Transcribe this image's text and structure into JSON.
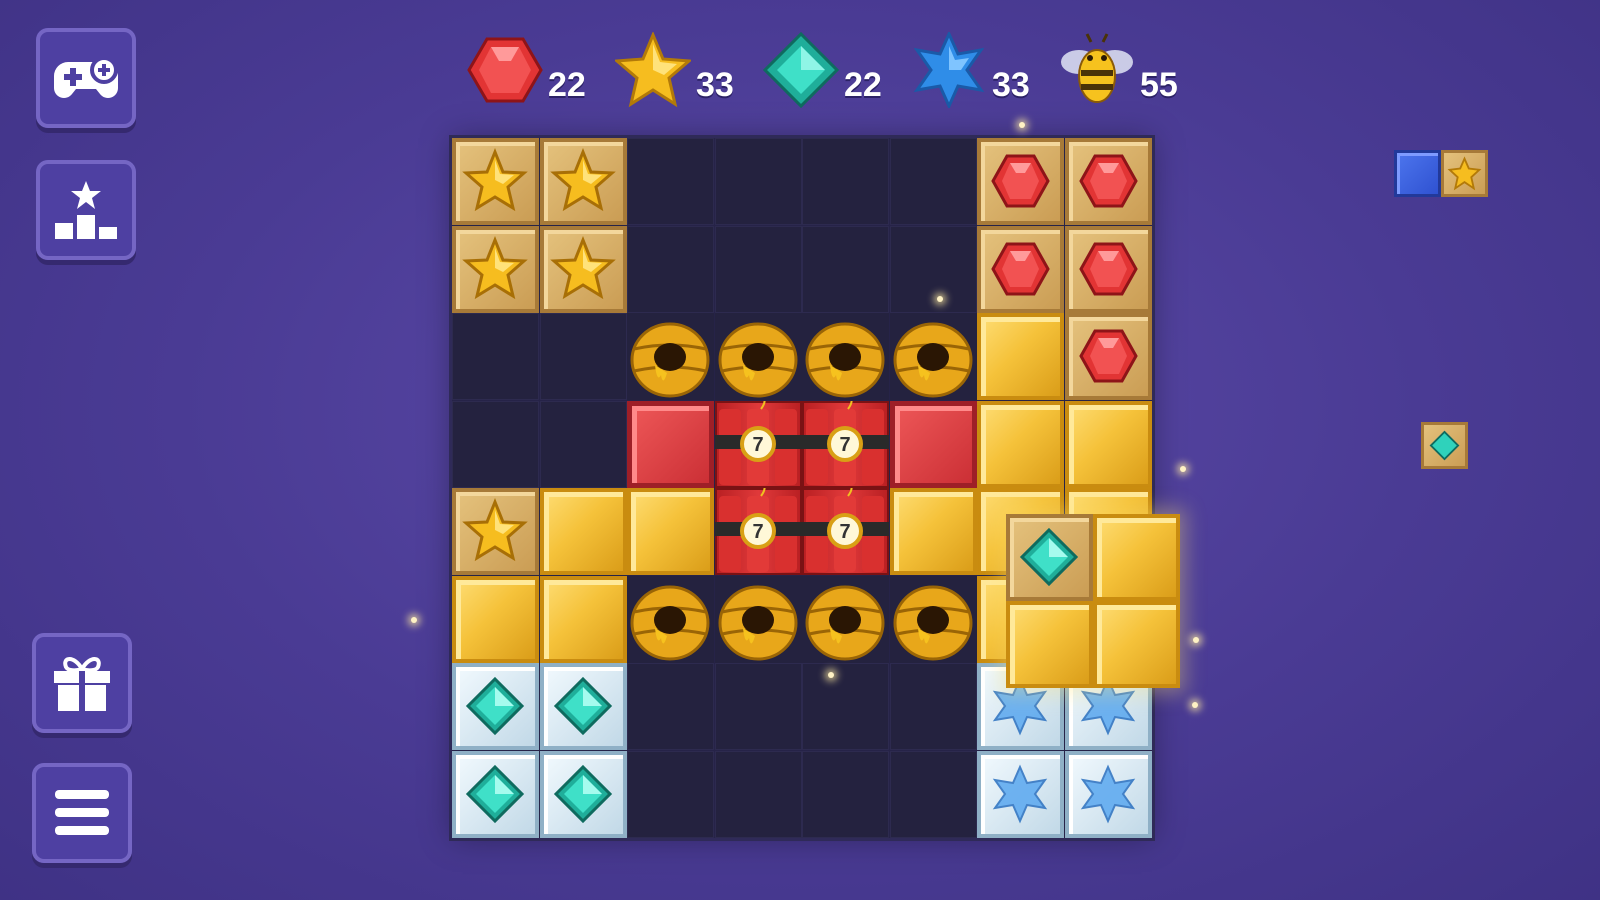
{
  "sidebar": {
    "games_icon": "gamepad-icon",
    "leaderboard_icon": "podium-star-icon",
    "gift_icon": "gift-icon",
    "menu_icon": "hamburger-menu-icon"
  },
  "goals": [
    {
      "icon": "red-hexagon-gem-icon",
      "count": "22"
    },
    {
      "icon": "gold-star-icon",
      "count": "33"
    },
    {
      "icon": "teal-diamond-gem-icon",
      "count": "22"
    },
    {
      "icon": "blue-star-icon",
      "count": "33"
    },
    {
      "icon": "bee-icon",
      "count": "55"
    }
  ],
  "board": {
    "rows": [
      [
        "tan-star",
        "tan-star",
        "empty",
        "empty",
        "empty",
        "empty",
        "tan-ruby",
        "tan-ruby"
      ],
      [
        "tan-star",
        "tan-star",
        "empty",
        "empty",
        "empty",
        "empty",
        "tan-ruby",
        "tan-ruby"
      ],
      [
        "empty",
        "empty",
        "honey",
        "honey",
        "honey",
        "honey",
        "gold",
        "tan-ruby"
      ],
      [
        "empty",
        "empty",
        "red",
        "dynamite",
        "dynamite",
        "red",
        "gold",
        "gold"
      ],
      [
        "tan-star",
        "gold",
        "gold",
        "dynamite",
        "dynamite",
        "gold",
        "gold",
        "gold"
      ],
      [
        "gold",
        "gold",
        "honey",
        "honey",
        "honey",
        "honey",
        "gold",
        "gold"
      ],
      [
        "ice-diamond",
        "ice-diamond",
        "empty",
        "empty",
        "empty",
        "empty",
        "ice-bluestar",
        "ice-bluestar"
      ],
      [
        "ice-diamond",
        "ice-diamond",
        "empty",
        "empty",
        "empty",
        "empty",
        "ice-bluestar",
        "ice-bluestar"
      ]
    ],
    "dynamite_timer": "7"
  },
  "colors": {
    "background": "#4a3b94",
    "board": "#262348",
    "gold": "#f5c23a",
    "red": "#e0393a",
    "teal": "#2ec9b5",
    "blue_piece": "#3b5fd6"
  }
}
